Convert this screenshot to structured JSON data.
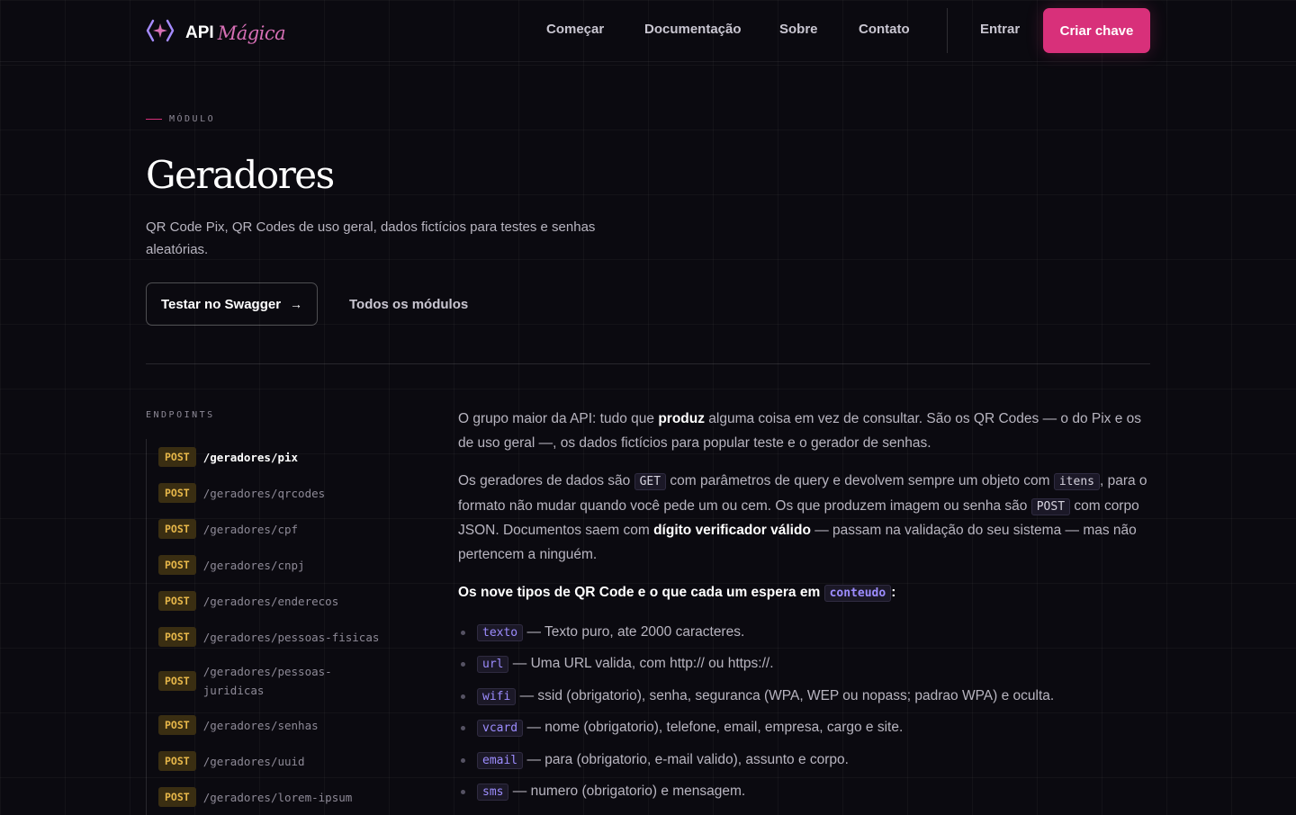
{
  "header": {
    "logo_api": "API",
    "logo_magica": "Mágica",
    "nav": [
      "Começar",
      "Documentação",
      "Sobre",
      "Contato"
    ],
    "login": "Entrar",
    "cta": "Criar chave"
  },
  "hero": {
    "eyebrow": "MÓDULO",
    "title": "Geradores",
    "subtitle": "QR Code Pix, QR Codes de uso geral, dados fictícios para testes e senhas aleatórias.",
    "swagger_button": "Testar no Swagger",
    "all_modules": "Todos os módulos"
  },
  "endpoints": {
    "label": "ENDPOINTS",
    "items": [
      {
        "method": "POST",
        "path": "/geradores/pix",
        "active": true
      },
      {
        "method": "POST",
        "path": "/geradores/qrcodes"
      },
      {
        "method": "POST",
        "path": "/geradores/cpf"
      },
      {
        "method": "POST",
        "path": "/geradores/cnpj"
      },
      {
        "method": "POST",
        "path": "/geradores/enderecos"
      },
      {
        "method": "POST",
        "path": "/geradores/pessoas-fisicas"
      },
      {
        "method": "POST",
        "path": "/geradores/pessoas-juridicas"
      },
      {
        "method": "POST",
        "path": "/geradores/senhas"
      },
      {
        "method": "POST",
        "path": "/geradores/uuid"
      },
      {
        "method": "POST",
        "path": "/geradores/lorem-ipsum"
      }
    ]
  },
  "content": {
    "p1_a": "O grupo maior da API: tudo que ",
    "p1_b": "produz",
    "p1_c": " alguma coisa em vez de consultar. São os QR Codes — o do Pix e os de uso geral —, os dados fictícios para popular teste e o gerador de senhas.",
    "p2_a": "Os geradores de dados são ",
    "p2_code1": "GET",
    "p2_b": " com parâmetros de query e devolvem sempre um objeto com ",
    "p2_code2": "itens",
    "p2_c": ", para o formato não mudar quando você pede um ou cem. Os que produzem imagem ou senha são ",
    "p2_code3": "POST",
    "p2_d": " com corpo JSON. Documentos saem com ",
    "p2_e": "dígito verificador válido",
    "p2_f": " — passam na validação do seu sistema — mas não pertencem a ninguém.",
    "qr_head_a": "Os nove tipos de QR Code e o que cada um espera em ",
    "qr_head_code": "conteudo",
    "qr_head_b": ":",
    "qr_types": [
      {
        "code": "texto",
        "desc": " — Texto puro, ate 2000 caracteres."
      },
      {
        "code": "url",
        "desc": " — Uma URL valida, com http:// ou https://."
      },
      {
        "code": "wifi",
        "desc": " — ssid (obrigatorio), senha, seguranca (WPA, WEP ou nopass; padrao WPA) e oculta."
      },
      {
        "code": "vcard",
        "desc": " — nome (obrigatorio), telefone, email, empresa, cargo e site."
      },
      {
        "code": "email",
        "desc": " — para (obrigatorio, e-mail valido), assunto e corpo."
      },
      {
        "code": "sms",
        "desc": " — numero (obrigatorio) e mensagem."
      }
    ]
  }
}
